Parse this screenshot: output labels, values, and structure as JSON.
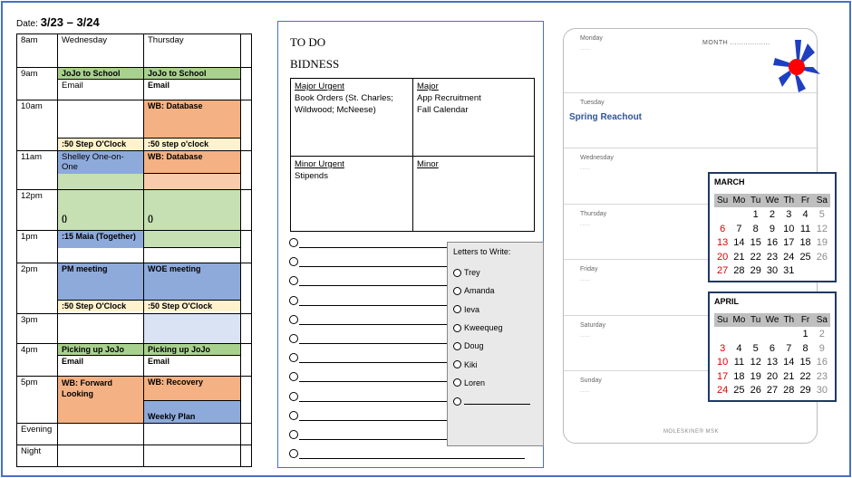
{
  "date": {
    "label": "Date:",
    "range": "3/23 – 3/24"
  },
  "schedule": {
    "headers": {
      "time": "8am",
      "col1": "Wednesday",
      "col2": "Thursday"
    },
    "rows": [
      {
        "time": "9am",
        "wed": [
          "JoJo to School",
          "Email"
        ],
        "thu": [
          "JoJo to School",
          "Email"
        ]
      },
      {
        "time": "10am",
        "wed": [
          "",
          ":50 Step O'Clock"
        ],
        "thu": [
          "WB: Database",
          ":50 step o'clock"
        ]
      },
      {
        "time": "11am",
        "wed": [
          "Shelley One-on-One",
          ""
        ],
        "thu": [
          "WB: Database",
          ""
        ]
      },
      {
        "time": "12pm",
        "wed": [
          "()"
        ],
        "thu": [
          "()"
        ]
      },
      {
        "time": "1pm",
        "wed": [
          ":15 Maia (Together)"
        ],
        "thu": [
          ""
        ]
      },
      {
        "time": "2pm",
        "wed": [
          "PM meeting",
          ":50 Step O'Clock"
        ],
        "thu": [
          "WOE meeting",
          ":50 Step O'Clock"
        ]
      },
      {
        "time": "3pm",
        "wed": [
          ""
        ],
        "thu": [
          ""
        ]
      },
      {
        "time": "4pm",
        "wed": [
          "Picking up JoJo",
          "Email"
        ],
        "thu": [
          "Picking up JoJo",
          "Email"
        ]
      },
      {
        "time": "5pm",
        "wed": [
          "WB: Forward Looking"
        ],
        "thu": [
          "WB: Recovery",
          "Weekly Plan"
        ]
      },
      {
        "time": "Evening",
        "wed": [
          ""
        ],
        "thu": [
          ""
        ]
      },
      {
        "time": "Night",
        "wed": [
          ""
        ],
        "thu": [
          ""
        ]
      }
    ]
  },
  "todo": {
    "title1": "TO DO",
    "title2": "BIDNESS",
    "quadrants": [
      {
        "heading": "Major Urgent",
        "body": "Book Orders (St. Charles; Wildwood; McNeese)"
      },
      {
        "heading": "Major",
        "body": "App Recruitment\nFall Calendar"
      },
      {
        "heading": "Minor Urgent",
        "body": "Stipends"
      },
      {
        "heading": "Minor",
        "body": ""
      }
    ],
    "letters": {
      "heading": "Letters to Write:",
      "names": [
        "Trey",
        "Amanda",
        "Ieva",
        "Kweequeg",
        "Doug",
        "Kiki",
        "Loren"
      ]
    }
  },
  "planner": {
    "month_label": "MONTH ..................",
    "days": [
      "Monday",
      "Tuesday",
      "Wednesday",
      "Thursday",
      "Friday",
      "Saturday",
      "Sunday"
    ],
    "note": "Spring Reachout",
    "brand": "MOLESKINE® MSK"
  },
  "calendars": {
    "weekday_headers": [
      "Su",
      "Mo",
      "Tu",
      "We",
      "Th",
      "Fr",
      "Sa"
    ],
    "months": [
      {
        "name": "MARCH",
        "weeks": [
          [
            "",
            "",
            "1",
            "2",
            "3",
            "4",
            "5"
          ],
          [
            "6",
            "7",
            "8",
            "9",
            "10",
            "11",
            "12"
          ],
          [
            "13",
            "14",
            "15",
            "16",
            "17",
            "18",
            "19"
          ],
          [
            "20",
            "21",
            "22",
            "23",
            "24",
            "25",
            "26"
          ],
          [
            "27",
            "28",
            "29",
            "30",
            "31",
            "",
            ""
          ]
        ]
      },
      {
        "name": "APRIL",
        "weeks": [
          [
            "",
            "",
            "",
            "",
            "",
            "1",
            "2"
          ],
          [
            "3",
            "4",
            "5",
            "6",
            "7",
            "8",
            "9"
          ],
          [
            "10",
            "11",
            "12",
            "13",
            "14",
            "15",
            "16"
          ],
          [
            "17",
            "18",
            "19",
            "20",
            "21",
            "22",
            "23"
          ],
          [
            "24",
            "25",
            "26",
            "27",
            "28",
            "29",
            "30"
          ]
        ]
      }
    ]
  },
  "colors": {
    "frame": "#4472c4",
    "green": "#a9d18e",
    "light_green": "#c6e0b4",
    "orange": "#f4b183",
    "light_orange": "#f8cbad",
    "blue": "#8eaadb",
    "light_blue": "#dae3f3",
    "yellow": "#fff2cc",
    "sunday_red": "#e00000"
  }
}
